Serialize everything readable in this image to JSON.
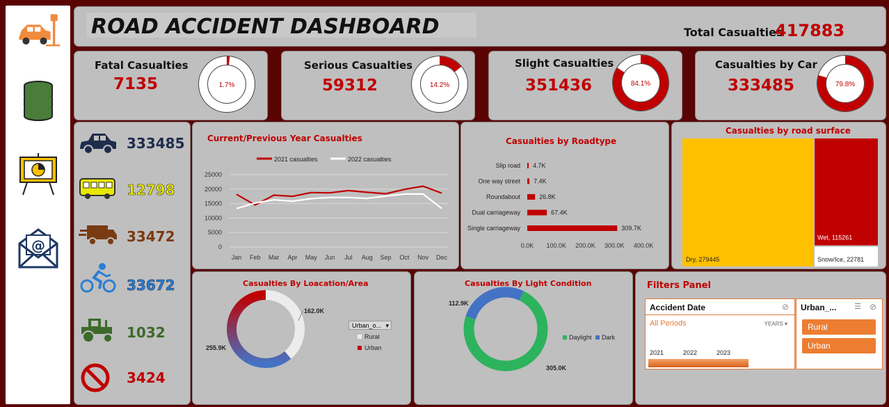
{
  "header": {
    "title": "ROAD ACCIDENT DASHBOARD",
    "total_label": "Total Casualties",
    "total_value": "417883"
  },
  "sidebar": {
    "icons": [
      "car-crash-icon",
      "database-icon",
      "presentation-chart-icon",
      "email-icon"
    ]
  },
  "kpis": [
    {
      "label": "Fatal Casualties",
      "value": "7135",
      "pct_label": "1.7%",
      "pct": 0.017
    },
    {
      "label": "Serious Casualties",
      "value": "59312",
      "pct_label": "14.2%",
      "pct": 0.142
    },
    {
      "label": "Slight Casualties",
      "value": "351436",
      "pct_label": "84.1%",
      "pct": 0.841
    },
    {
      "label": "Casualties by Car",
      "value": "333485",
      "pct_label": "79.8%",
      "pct": 0.798
    }
  ],
  "vehicles": [
    {
      "icon": "car-icon",
      "value": "333485",
      "color": "#1f2d4d"
    },
    {
      "icon": "bus-icon",
      "value": "12798",
      "color": "#e8e800"
    },
    {
      "icon": "truck-icon",
      "value": "33472",
      "color": "#7a3b12"
    },
    {
      "icon": "bicycle-icon",
      "value": "33672",
      "color": "#2a7fd4"
    },
    {
      "icon": "tractor-icon",
      "value": "1032",
      "color": "#3c6a2a"
    },
    {
      "icon": "no-entry-icon",
      "value": "3424",
      "color": "#c00000"
    }
  ],
  "colors": {
    "accent": "#c00000",
    "yellow": "#ffc000",
    "orange": "#ed7d31",
    "panel": "#bfbfbf"
  },
  "chart_data": [
    {
      "type": "line",
      "title": "Current/Previous  Year Casualties",
      "categories": [
        "Jan",
        "Feb",
        "Mar",
        "Apr",
        "May",
        "Jun",
        "Jul",
        "Aug",
        "Sep",
        "Oct",
        "Nov",
        "Dec"
      ],
      "series": [
        {
          "name": "2021 casualties",
          "color": "#c00000",
          "values": [
            18200,
            14500,
            17900,
            17500,
            18800,
            18700,
            19500,
            18900,
            18400,
            19900,
            21000,
            18600
          ]
        },
        {
          "name": "2022 casualties",
          "color": "#ffffff",
          "values": [
            13300,
            15200,
            16300,
            15800,
            16700,
            17100,
            17100,
            16800,
            17600,
            18300,
            18300,
            13300
          ]
        }
      ],
      "yticks": [
        "0",
        "5000",
        "10000",
        "15000",
        "20000",
        "25000"
      ],
      "ylim": [
        0,
        25000
      ],
      "grid": true,
      "legend": "top"
    },
    {
      "type": "bar",
      "title": "Casualties by Roadtype",
      "categories": [
        "Slip road",
        "One way street",
        "Roundabout",
        "Dual carriageway",
        "Single carriageway"
      ],
      "values": [
        4700,
        7400,
        26800,
        67400,
        309700
      ],
      "data_labels": [
        "4.7K",
        "7.4K",
        "26.8K",
        "67.4K",
        "309.7K"
      ],
      "xticks": [
        "0.0K",
        "100.0K",
        "200.0K",
        "300.0K",
        "400.0K"
      ],
      "xlim": [
        0,
        400000
      ]
    },
    {
      "type": "treemap",
      "title": "Casualties by road surface",
      "items": [
        {
          "label": "Dry, 279445",
          "value": 279445,
          "color": "#ffc000"
        },
        {
          "label": "Wet, 115261",
          "value": 115261,
          "color": "#c00000"
        },
        {
          "label": "Snow/Ice, 22781",
          "value": 22781,
          "color": "#ffffff"
        }
      ]
    },
    {
      "type": "pie",
      "title": "Casualties By Loacation/Area",
      "slices": [
        {
          "name": "Rural",
          "value": 162000,
          "label": "162.0K"
        },
        {
          "name": "Urban",
          "value": 255900,
          "label": "255.9K"
        }
      ],
      "filter_label": "Urban_o...",
      "legend": "right"
    },
    {
      "type": "pie",
      "title": "Casualties By Light Condition",
      "slices": [
        {
          "name": "Daylight",
          "value": 305000,
          "label": "305.0K"
        },
        {
          "name": "Dark",
          "value": 112900,
          "label": "112.9K"
        }
      ],
      "legend": "right"
    }
  ],
  "filters": {
    "title": "Filters Panel",
    "date_slicer": {
      "title": "Accident Date",
      "periods": "All Periods",
      "unit": "YEARS",
      "years": [
        "2021",
        "2022",
        "2023"
      ]
    },
    "area_slicer": {
      "title": "Urban_...",
      "options": [
        "Rural",
        "Urban"
      ]
    }
  }
}
